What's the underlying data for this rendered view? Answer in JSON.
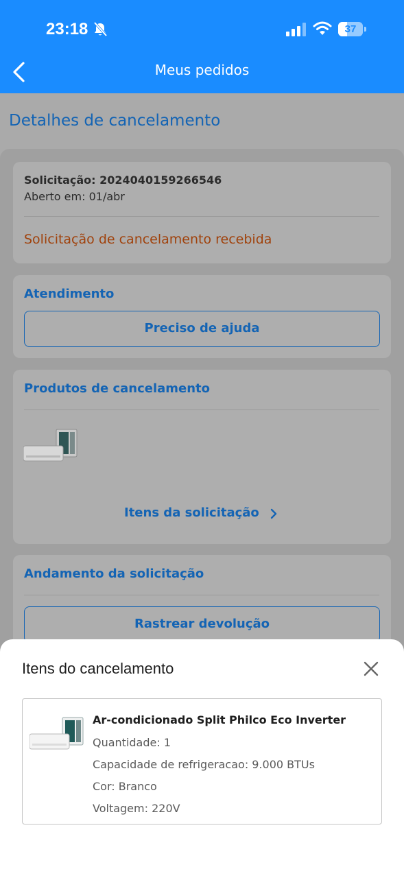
{
  "status_bar": {
    "time": "23:18",
    "battery": "37",
    "battery_level": 0.37
  },
  "nav": {
    "title": "Meus pedidos",
    "back_icon": "chevron-left-icon"
  },
  "page": {
    "heading": "Detalhes de cancelamento"
  },
  "request_card": {
    "id_line": "Solicitação: 2024040159266546",
    "opened_line": "Aberto em: 01/abr",
    "status": "Solicitação de cancelamento recebida"
  },
  "support_card": {
    "title": "Atendimento",
    "help_button": "Preciso de ajuda"
  },
  "products_card": {
    "title": "Produtos de cancelamento",
    "items_link": "Itens da solicitação"
  },
  "progress_card": {
    "title": "Andamento da solicitação",
    "track_button": "Rastrear devolução"
  },
  "sheet": {
    "title": "Itens do cancelamento",
    "item": {
      "name": "Ar-condicionado Split Philco Eco Inverter",
      "quantity": "Quantidade: 1",
      "capacity": "Capacidade de refrigeracao: 9.000 BTUs",
      "color": "Cor: Branco",
      "voltage": "Voltagem: 220V"
    }
  },
  "colors": {
    "brand_blue": "#1a8cff",
    "link_blue": "#1464b4",
    "status_orange": "#a0420c"
  }
}
